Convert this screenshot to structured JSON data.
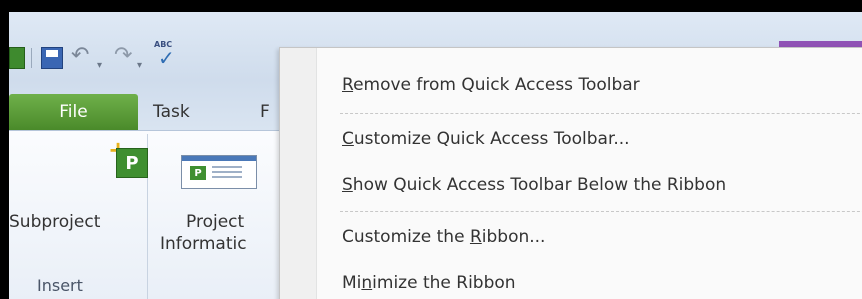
{
  "qat": {
    "undo_glyph": "↶",
    "redo_glyph": "↷",
    "dropdown_glyph": "▾",
    "spell_abc": "ABC",
    "spell_check": "✓"
  },
  "tabs": {
    "file": "File",
    "task": "Task",
    "partial": "F"
  },
  "ribbon": {
    "subproject_label": "Subproject",
    "subproject_icon_letter": "P",
    "projinfo_line1": "Project",
    "projinfo_line2": "Informatic",
    "projinfo_icon_letter": "P",
    "group_insert": "Insert"
  },
  "menu": {
    "items": [
      {
        "pre": "",
        "mn": "R",
        "post": "emove from Quick Access Toolbar"
      },
      {
        "pre": "",
        "mn": "C",
        "post": "ustomize Quick Access Toolbar..."
      },
      {
        "pre": "",
        "mn": "S",
        "post": "how Quick Access Toolbar Below the Ribbon"
      },
      {
        "pre": "Customize the ",
        "mn": "R",
        "post": "ibbon..."
      },
      {
        "pre": "Mi",
        "mn": "n",
        "post": "imize the Ribbon"
      }
    ]
  },
  "colors": {
    "file_tab": "#5c9e3a",
    "context_tab": "#8f52b5",
    "qat_bg": "#d6e2f0"
  }
}
